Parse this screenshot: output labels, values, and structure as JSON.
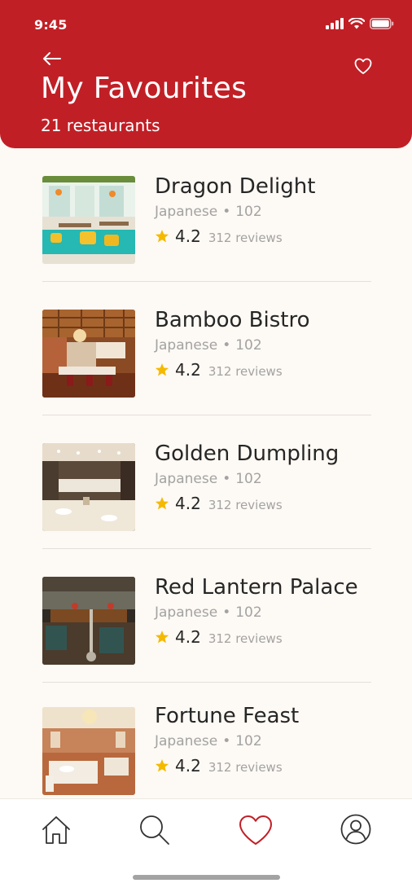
{
  "status_bar": {
    "time": "9:45"
  },
  "header": {
    "title": "My Favourites",
    "subtitle": "21 restaurants",
    "back_icon": "arrow-left-icon",
    "favorite_icon": "heart-outline-icon"
  },
  "restaurants": [
    {
      "name": "Dragon Delight",
      "cuisine": "Japanese",
      "separator": "•",
      "code": "102",
      "rating": "4.2",
      "reviews": "312 reviews",
      "image": "bright-teal-dining-room"
    },
    {
      "name": "Bamboo Bistro",
      "cuisine": "Japanese",
      "separator": "•",
      "code": "102",
      "rating": "4.2",
      "reviews": "312 reviews",
      "image": "wood-ceiling-dining-room"
    },
    {
      "name": "Golden Dumpling",
      "cuisine": "Japanese",
      "separator": "•",
      "code": "102",
      "rating": "4.2",
      "reviews": "312 reviews",
      "image": "white-tablecloth-hall"
    },
    {
      "name": "Red Lantern Palace",
      "cuisine": "Japanese",
      "separator": "•",
      "code": "102",
      "rating": "4.2",
      "reviews": "312 reviews",
      "image": "dark-lounge-with-hookah"
    },
    {
      "name": "Fortune Feast",
      "cuisine": "Japanese",
      "separator": "•",
      "code": "102",
      "rating": "4.2",
      "reviews": "312 reviews",
      "image": "chandelier-banquet-hall"
    }
  ],
  "tab_bar": {
    "items": [
      {
        "icon": "home-icon",
        "active": false
      },
      {
        "icon": "search-icon",
        "active": false
      },
      {
        "icon": "heart-icon",
        "active": true
      },
      {
        "icon": "profile-icon",
        "active": false
      }
    ]
  },
  "colors": {
    "brand": "#c11f26",
    "background": "#fdf9f4",
    "star": "#f5b900",
    "muted_text": "#a3a3a3"
  }
}
